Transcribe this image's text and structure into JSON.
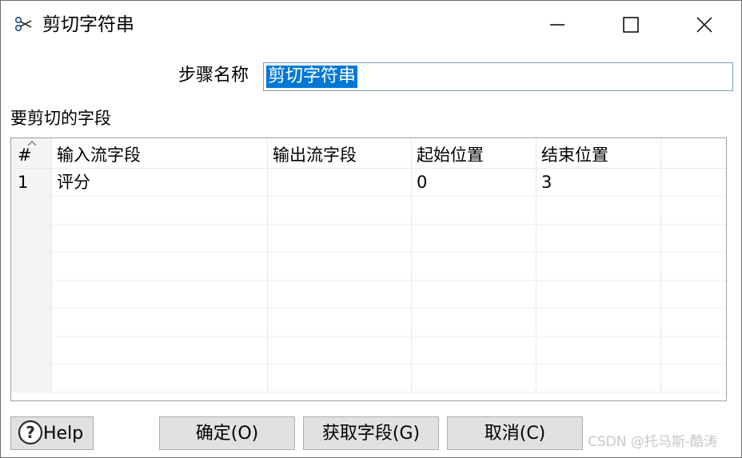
{
  "window": {
    "title": "剪切字符串"
  },
  "step": {
    "label": "步骤名称",
    "value": "剪切字符串"
  },
  "fields_section": {
    "label": "要剪切的字段"
  },
  "table": {
    "columns": [
      "#",
      "输入流字段",
      "输出流字段",
      "起始位置",
      "结束位置"
    ],
    "rows": [
      {
        "index": "1",
        "input_field": "评分",
        "output_field": "",
        "start": "0",
        "end": "3"
      }
    ]
  },
  "buttons": {
    "help": "Help",
    "ok": "确定(O)",
    "get_fields": "获取字段(G)",
    "cancel": "取消(C)"
  },
  "watermark": "CSDN @托马斯-酷涛",
  "colors": {
    "selection": "#0078d7",
    "input_border": "#7a9ec2",
    "button_bg": "#e1e1e1"
  }
}
